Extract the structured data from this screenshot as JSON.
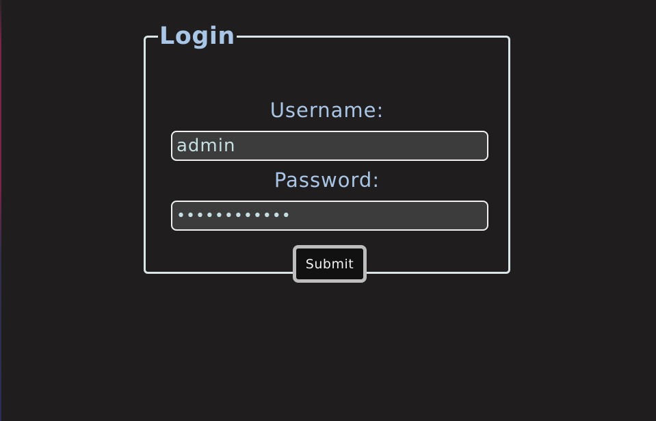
{
  "login_form": {
    "legend": "Login",
    "username_label": "Username:",
    "username_value": "admin",
    "password_label": "Password:",
    "password_value": "••••••••••••",
    "submit_label": "Submit"
  },
  "colors": {
    "background": "#1f1d1d",
    "accent_text": "#aac6e6",
    "panel_border": "#d8e4e6",
    "input_background": "#3c3c3c",
    "input_text": "#c5dfe2",
    "button_background": "#111111",
    "button_border": "#bdbdbd"
  }
}
